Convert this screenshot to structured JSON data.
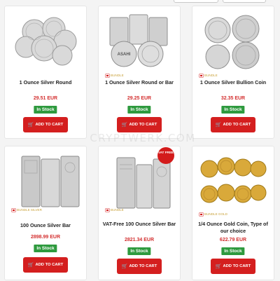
{
  "watermark": "CRYPTWERK.COM",
  "colors": {
    "price": "#d32f2f",
    "in_stock": "#2e9a3e",
    "add_to_cart": "#d41f1f",
    "page_bg": "#f4f4f4"
  },
  "products": [
    {
      "title": "1 Ounce Silver Round",
      "price": "29.51 EUR",
      "stock": "In Stock",
      "cart_label": "ADD TO CART",
      "cart_icon": "cart-icon"
    },
    {
      "title": "1 Ounce Silver Round or Bar",
      "price": "29.25 EUR",
      "stock": "In Stock",
      "cart_label": "ADD TO CART",
      "cart_icon": "cart-icon",
      "flag_label": "BUNDLE"
    },
    {
      "title": "1 Ounce Silver Bullion Coin",
      "price": "32.35 EUR",
      "stock": "In Stock",
      "cart_label": "ADD TO CART",
      "cart_icon": "cart-icon",
      "flag_label": "BUNDLE"
    },
    {
      "title": "100 Ounce Silver Bar",
      "price": "2898.99 EUR",
      "stock": "In Stock",
      "cart_label": "ADD TO CART",
      "cart_icon": "cart-icon",
      "flag_label": "BUNDLE SILVER"
    },
    {
      "title": "VAT-Free 100 Ounce Silver Bar",
      "price": "2821.34 EUR",
      "stock": "In Stock",
      "cart_label": "ADD TO CART",
      "cart_icon": "cart-icon",
      "flag_label": "BUNDLE",
      "badge": "VAT FREE"
    },
    {
      "title": "1/4 Ounce Gold Coin, Type of our choice",
      "price": "622.79 EUR",
      "stock": "In Stock",
      "cart_label": "ADD TO CART",
      "cart_icon": "cart-icon",
      "flag_label": "BUNDLE GOLD"
    }
  ]
}
